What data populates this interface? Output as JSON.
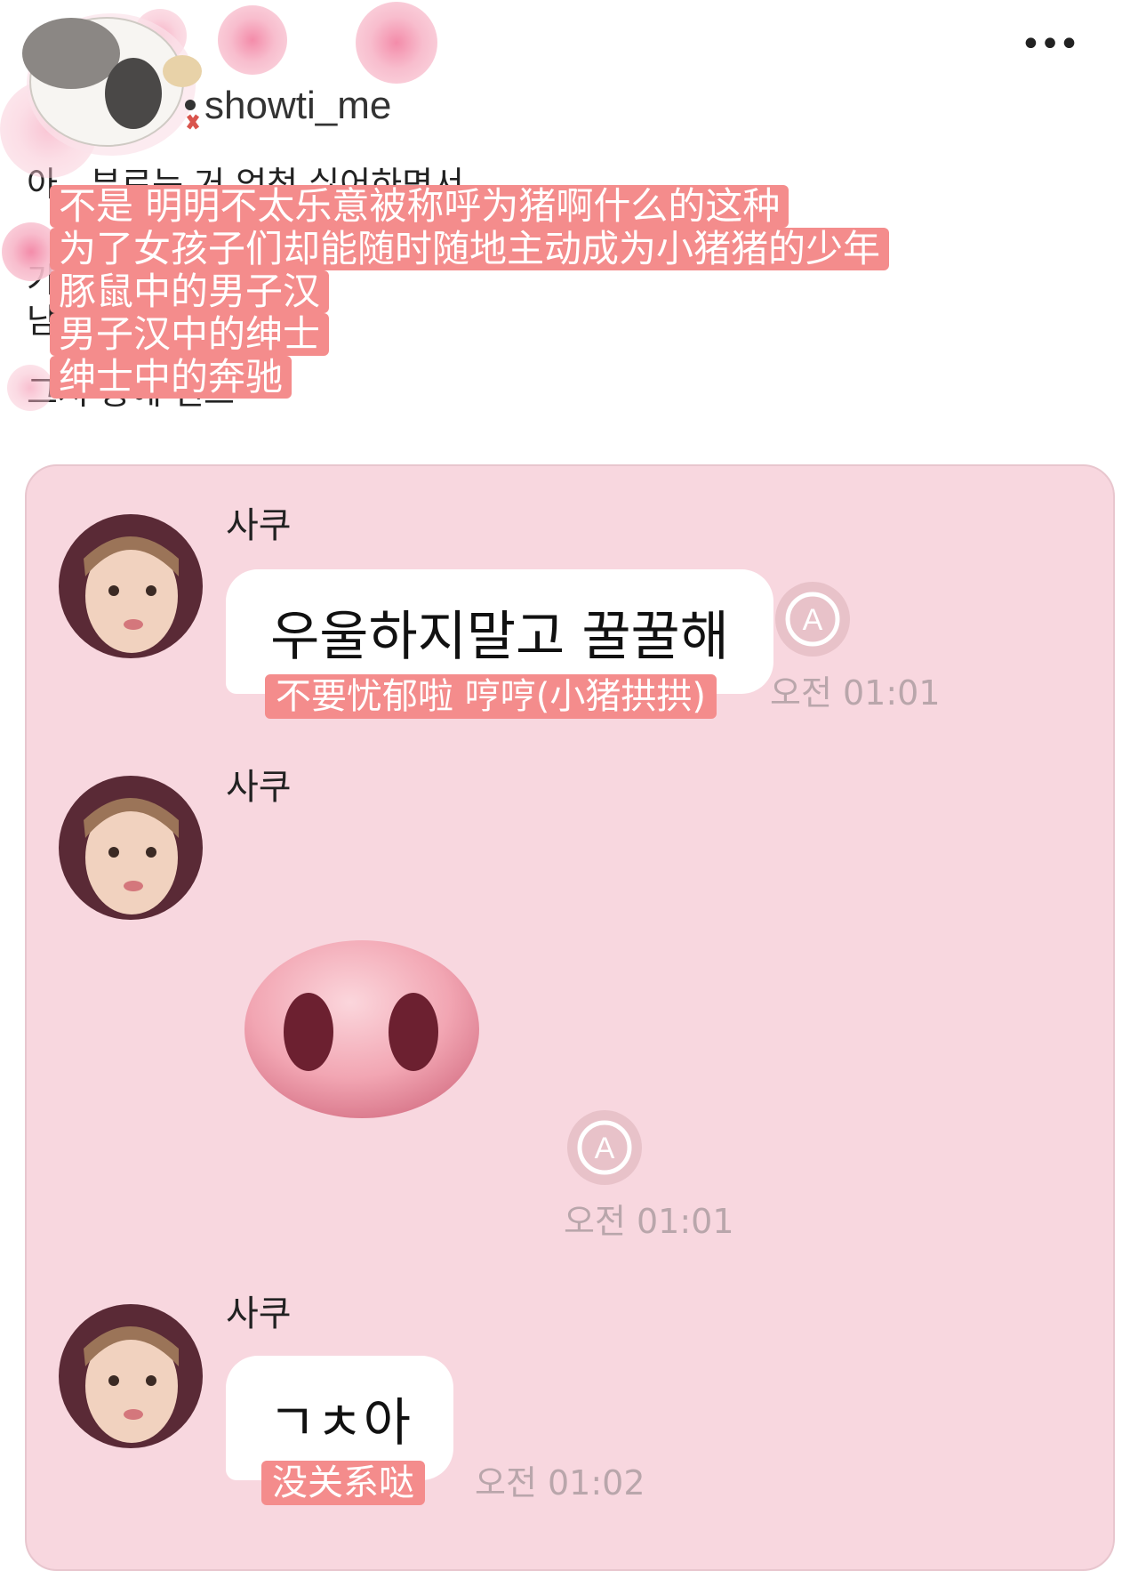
{
  "post": {
    "more_label": "•••",
    "username": "showti_me",
    "korean_lines": [
      "아     . 부르는 거 엄청 싫어하면서",
      "가",
      "남",
      "그저 중에 벤츠"
    ],
    "chinese_caption": [
      "不是 明明不太乐意被称呼为猪啊什么的这种",
      "为了女孩子们却能随时随地主动成为小猪猪的少年",
      "豚鼠中的男子汉",
      "男子汉中的绅士",
      "绅士中的奔驰"
    ]
  },
  "chat": {
    "messages": [
      {
        "sender": "사쿠",
        "text": "우울하지말고 꿀꿀해",
        "subtitle": "不要忧郁啦 哼哼(小猪拱拱)",
        "time": "오전 01:01"
      },
      {
        "sender": "사쿠",
        "sticker": "pig-snout",
        "time": "오전 01:01"
      },
      {
        "sender": "사쿠",
        "text": "ㄱㅊ아",
        "subtitle": "没关系哒",
        "time": "오전 01:02"
      }
    ]
  },
  "colors": {
    "card_bg": "#f8d7df",
    "caption_bg": "#f48c8c",
    "timestamp": "#b9a6ab"
  },
  "icons": [
    "more-icon",
    "guinea-pig-sticker",
    "sakura-flower-icon",
    "translate-icon",
    "pig-snout-emoji"
  ]
}
